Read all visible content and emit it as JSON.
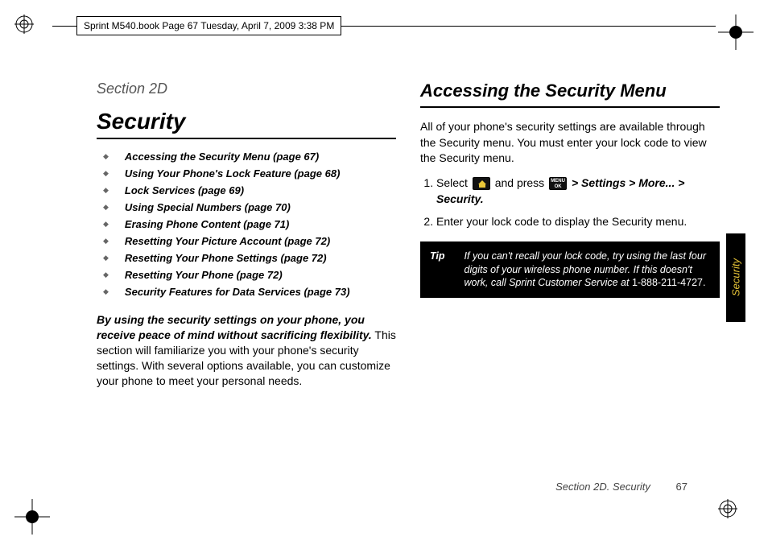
{
  "header_text": "Sprint M540.book  Page 67  Tuesday, April 7, 2009  3:38 PM",
  "left": {
    "section_label": "Section 2D",
    "title": "Security",
    "toc": [
      "Accessing the Security Menu (page 67)",
      "Using Your Phone's Lock Feature (page 68)",
      "Lock Services (page 69)",
      "Using Special Numbers (page 70)",
      "Erasing Phone Content (page 71)",
      "Resetting Your Picture Account (page 72)",
      "Resetting Your Phone Settings (page 72)",
      "Resetting Your Phone (page 72)",
      "Security Features for Data Services (page 73)"
    ],
    "intro_lead": "By using the security settings on your phone, you receive peace of mind without sacrificing flexibility.",
    "intro_rest": " This section will familiarize you with your phone's security settings. With several options available, you can customize your phone to meet your personal needs."
  },
  "right": {
    "heading": "Accessing the Security Menu",
    "para": "All of your phone's security settings are available through the Security menu. You must enter your lock code to view the Security menu.",
    "step1_a": "Select ",
    "step1_b": " and press ",
    "step1_path": " > Settings > More... > Security.",
    "step2": "Enter your lock code to display the Security menu.",
    "tip_label": "Tip",
    "tip_body_a": "If you can't recall your lock code, try using the last four digits of your wireless phone number. If this doesn't work, call Sprint Customer Service at ",
    "tip_phone": "1-888-211-4727."
  },
  "side_tab": "Security",
  "footer_label": "Section 2D. Security",
  "footer_page": "67"
}
